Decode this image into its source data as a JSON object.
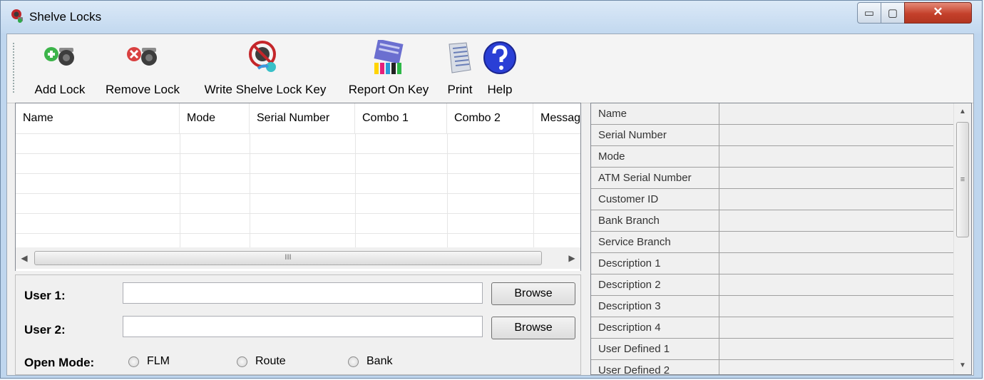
{
  "window": {
    "title": "Shelve Locks",
    "controls": {
      "minimize": "▭",
      "maximize": "▢",
      "close": "✕"
    }
  },
  "toolbar": {
    "add_lock": "Add Lock",
    "remove_lock": "Remove Lock",
    "write_key": "Write Shelve Lock Key",
    "report_on_key": "Report On Key",
    "print": "Print",
    "help": "Help"
  },
  "grid": {
    "columns": [
      "Name",
      "Mode",
      "Serial Number",
      "Combo 1",
      "Combo 2",
      "Messag"
    ],
    "rows": [],
    "scroll_grip": "III"
  },
  "users": {
    "user1_label": "User 1:",
    "user1_value": "",
    "user2_label": "User 2:",
    "user2_value": "",
    "browse_label": "Browse"
  },
  "open_mode": {
    "label": "Open Mode:",
    "options": [
      "FLM",
      "Route",
      "Bank"
    ]
  },
  "properties": {
    "rows": [
      "Name",
      "Serial Number",
      "Mode",
      "ATM Serial Number",
      "Customer ID",
      "Bank Branch",
      "Service Branch",
      "Description 1",
      "Description 2",
      "Description 3",
      "Description 4",
      "User Defined 1",
      "User Defined 2"
    ],
    "scroll_grip": "≡"
  },
  "colors": {
    "title_bg": "#c2d8ef",
    "close_btn": "#c4402b",
    "help_blue": "#2a3fd6"
  }
}
